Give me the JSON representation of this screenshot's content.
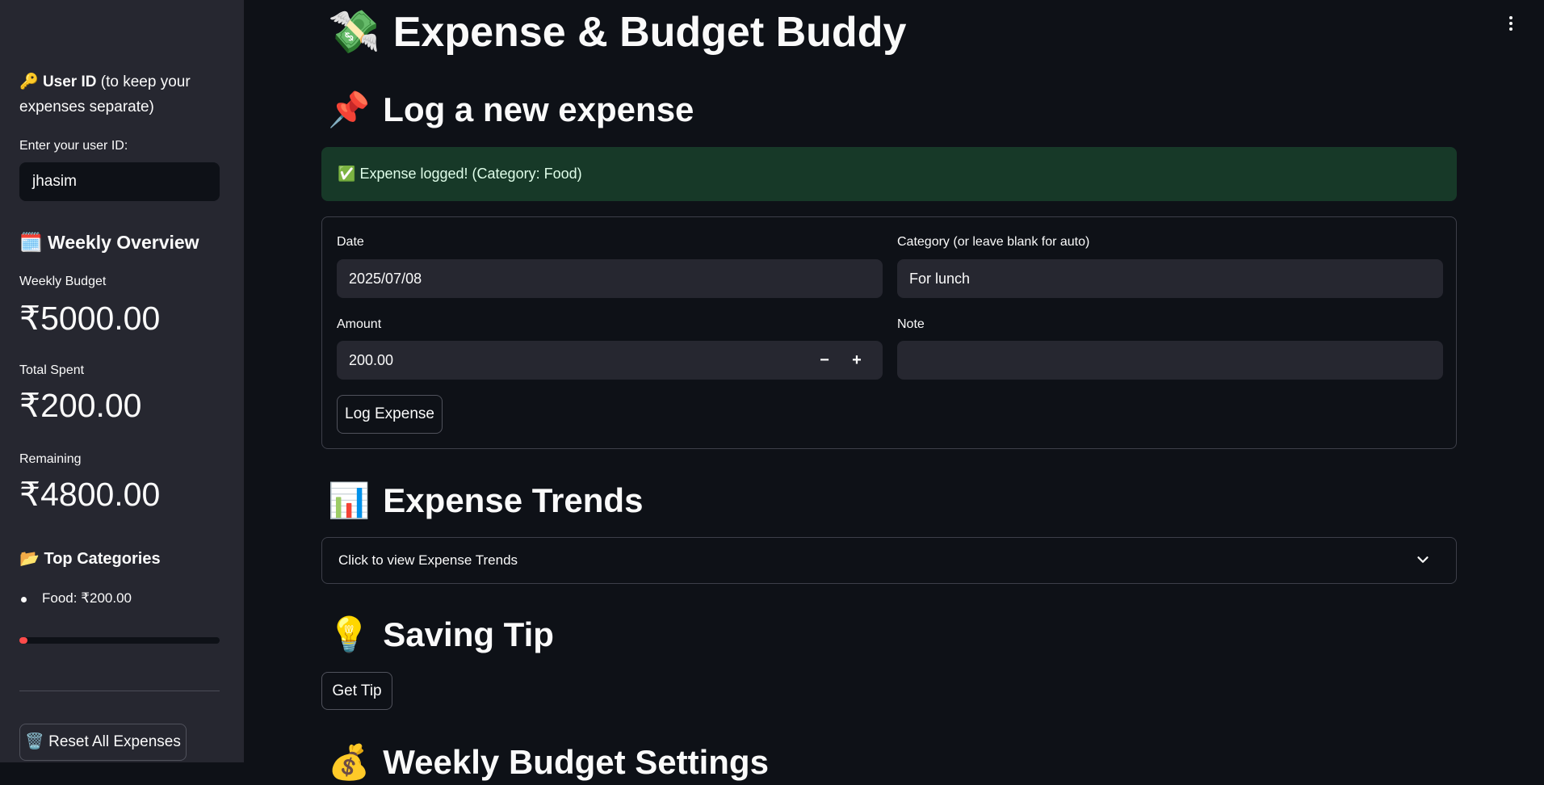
{
  "app": {
    "title": "Expense & Budget Buddy",
    "title_icon": "money-with-wings-icon"
  },
  "sidebar": {
    "userid_heading_bold": "User ID",
    "userid_heading_rest": "(to keep your expenses separate)",
    "userid_label": "Enter your user ID:",
    "userid_value": "jhasim",
    "weekly_overview_heading": "Weekly Overview",
    "metrics": [
      {
        "label": "Weekly Budget",
        "value": "₹5000.00"
      },
      {
        "label": "Total Spent",
        "value": "₹200.00"
      },
      {
        "label": "Remaining",
        "value": "₹4800.00"
      }
    ],
    "top_categories_heading": "Top Categories",
    "top_categories": [
      "Food: ₹200.00"
    ],
    "progress_fraction": 0.04,
    "reset_button": "Reset All Expenses"
  },
  "log_section": {
    "heading": "Log a new expense",
    "success_message": "Expense logged! (Category: Food)",
    "date_label": "Date",
    "date_value": "2025/07/08",
    "category_label": "Category (or leave blank for auto)",
    "category_value": "For lunch",
    "amount_label": "Amount",
    "amount_value": "200.00",
    "minus": "−",
    "plus": "+",
    "note_label": "Note",
    "note_value": "",
    "submit_button": "Log Expense"
  },
  "trends_section": {
    "heading": "Expense Trends",
    "expander_label": "Click to view Expense Trends"
  },
  "tip_section": {
    "heading": "Saving Tip",
    "button": "Get Tip"
  },
  "budget_section": {
    "heading": "Weekly Budget Settings"
  },
  "colors": {
    "background": "#0e1117",
    "sidebar": "#262730",
    "success_bg": "#173928",
    "progress": "#ff4b4b"
  }
}
